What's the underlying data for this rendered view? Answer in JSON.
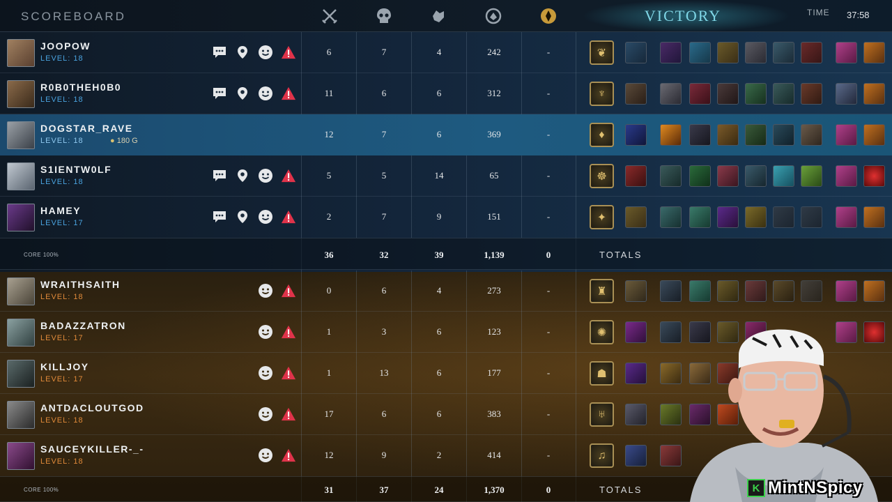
{
  "header": {
    "title": "SCOREBOARD",
    "result": "VICTORY",
    "time_label": "TIME",
    "time_value": "37:58",
    "columns": [
      "kills-icon",
      "deaths-icon",
      "assists-icon",
      "power-icon",
      "objective-icon"
    ]
  },
  "team1": {
    "players": [
      {
        "name": "JOOPOW",
        "level": "LEVEL: 18",
        "kills": "6",
        "deaths": "7",
        "assists": "4",
        "power": "242",
        "obj": "-",
        "social": true
      },
      {
        "name": "R0B0THEH0B0",
        "level": "LEVEL: 18",
        "kills": "11",
        "deaths": "6",
        "assists": "6",
        "power": "312",
        "obj": "-",
        "social": true
      },
      {
        "name": "DOGSTAR_RAVE",
        "level": "LEVEL: 18",
        "gold": "180 G",
        "kills": "12",
        "deaths": "7",
        "assists": "6",
        "power": "369",
        "obj": "-",
        "social": false
      },
      {
        "name": "S1IENTW0LF",
        "level": "LEVEL: 18",
        "kills": "5",
        "deaths": "5",
        "assists": "14",
        "power": "65",
        "obj": "-",
        "social": true
      },
      {
        "name": "HAMEY",
        "level": "LEVEL: 17",
        "kills": "2",
        "deaths": "7",
        "assists": "9",
        "power": "151",
        "obj": "-",
        "social": true
      }
    ],
    "core": "CORE 100%",
    "totals": {
      "kills": "36",
      "deaths": "32",
      "assists": "39",
      "power": "1,139",
      "obj": "0",
      "label": "TOTALS"
    }
  },
  "team2": {
    "players": [
      {
        "name": "WRAITHSAITH",
        "level": "LEVEL: 18",
        "kills": "0",
        "deaths": "6",
        "assists": "4",
        "power": "273",
        "obj": "-"
      },
      {
        "name": "BADAZZATRON",
        "level": "LEVEL: 17",
        "kills": "1",
        "deaths": "3",
        "assists": "6",
        "power": "123",
        "obj": "-"
      },
      {
        "name": "KILLJOY",
        "level": "LEVEL: 17",
        "kills": "1",
        "deaths": "13",
        "assists": "6",
        "power": "177",
        "obj": "-"
      },
      {
        "name": "ANTDACLOUTGOD",
        "level": "LEVEL: 18",
        "kills": "17",
        "deaths": "6",
        "assists": "6",
        "power": "383",
        "obj": "-"
      },
      {
        "name": "SAUCEYKILLER-_-",
        "level": "LEVEL: 18",
        "kills": "12",
        "deaths": "9",
        "assists": "2",
        "power": "414",
        "obj": "-"
      }
    ],
    "core": "CORE 100%",
    "totals": {
      "kills": "31",
      "deaths": "37",
      "assists": "24",
      "power": "1,370",
      "obj": "0",
      "label": "TOTALS"
    }
  },
  "streamer": {
    "watermark": "MintNSpicy",
    "logo_letter": "K"
  },
  "colors": {
    "team1_level": "#4aa3df",
    "team2_level": "#e08a3a",
    "report": "#e0334a",
    "highlight": "#1e5a80",
    "victory": "#7fd6e6"
  }
}
